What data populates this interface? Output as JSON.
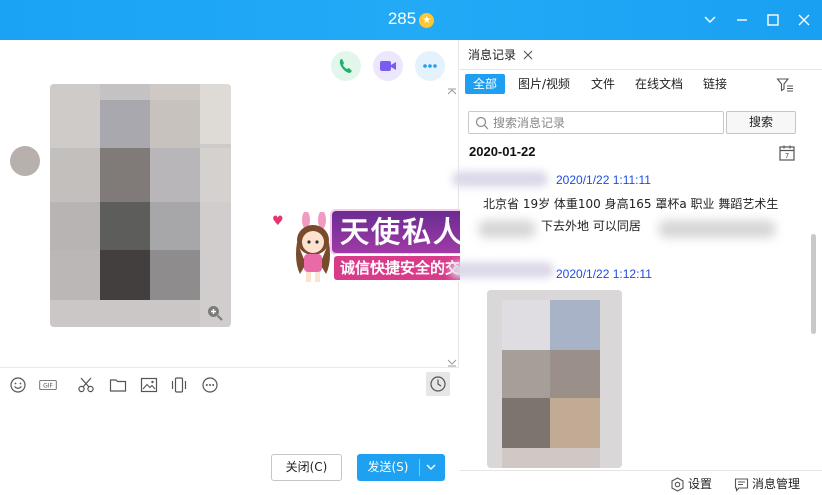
{
  "window": {
    "title": "285",
    "title_badge": "★",
    "controls": [
      "chevron-down-icon",
      "minimize-icon",
      "maximize-icon",
      "close-icon"
    ]
  },
  "chat": {
    "header_actions": [
      {
        "name": "voice-call",
        "color": "#20b16e"
      },
      {
        "name": "video-call",
        "color": "#7b5cf0"
      },
      {
        "name": "more",
        "color": "#1e9ff2"
      }
    ]
  },
  "ad": {
    "title": "天使私人订制",
    "subtitle": "诚信快捷安全的交友平台"
  },
  "toolbar": {
    "gif_label": "GIF",
    "tools": [
      "emoji-icon",
      "gif-icon",
      "scissors-icon",
      "folder-icon",
      "image-icon",
      "shake-icon",
      "more-icon"
    ]
  },
  "compose": {
    "close_label": "关闭(C)",
    "send_label": "发送(S)"
  },
  "history": {
    "tab_label": "消息记录",
    "filters": [
      "全部",
      "图片/视频",
      "文件",
      "在线文档",
      "链接"
    ],
    "active_filter": "全部",
    "search_placeholder": "搜索消息记录",
    "search_button": "搜索",
    "date": "2020-01-22",
    "messages": [
      {
        "time": "2020/1/22 1:11:11",
        "text_line1": "北京省 19岁 体重100 身高165 罩杯a 职业 舞蹈艺术生",
        "text_line2": "下去外地 可以同居"
      },
      {
        "time": "2020/1/22 1:12:11"
      }
    ],
    "footer": {
      "settings_label": "设置",
      "manage_label": "消息管理"
    }
  }
}
